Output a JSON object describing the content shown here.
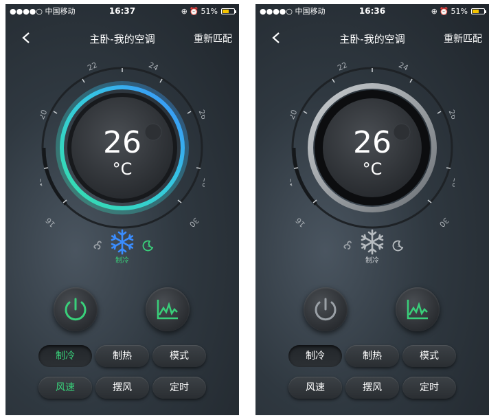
{
  "screens": [
    {
      "status": {
        "carrier": "●●●●○ 中国移动",
        "time": "16:37",
        "battery_text": "51%",
        "battery_level": 0.51
      },
      "nav": {
        "title": "主卧-我的空调",
        "rematch": "重新匹配"
      },
      "dial": {
        "ticks": [
          "16",
          "18",
          "20",
          "22",
          "24",
          "26",
          "28",
          "30"
        ],
        "state": "on"
      },
      "temperature": {
        "value": "26",
        "unit": "°C"
      },
      "mode": {
        "label": "制冷"
      },
      "buttons": {
        "cool": "制冷",
        "heat": "制热",
        "mode": "模式",
        "fan": "风速",
        "swing": "摆风",
        "timer": "定时"
      }
    },
    {
      "status": {
        "carrier": "●●●●○ 中国移动",
        "time": "16:36",
        "battery_text": "51%",
        "battery_level": 0.51
      },
      "nav": {
        "title": "主卧-我的空调",
        "rematch": "重新匹配"
      },
      "dial": {
        "ticks": [
          "16",
          "18",
          "20",
          "22",
          "24",
          "26",
          "28",
          "30"
        ],
        "state": "off"
      },
      "temperature": {
        "value": "26",
        "unit": "°C"
      },
      "mode": {
        "label": "制冷"
      },
      "buttons": {
        "cool": "制冷",
        "heat": "制热",
        "mode": "模式",
        "fan": "风速",
        "swing": "摆风",
        "timer": "定时"
      }
    }
  ],
  "colors": {
    "active_green": "#39d07a",
    "active_blue": "#3a8dff",
    "ring_teal": "#35e0c0",
    "inactive_gray": "#9aa0a6"
  },
  "icons": [
    "wifi-icon",
    "lock-icon",
    "alarm-icon",
    "battery-icon",
    "back-icon",
    "fan-icon",
    "snowflake-icon",
    "sleep-moon-icon",
    "power-icon",
    "stats-chart-icon"
  ]
}
